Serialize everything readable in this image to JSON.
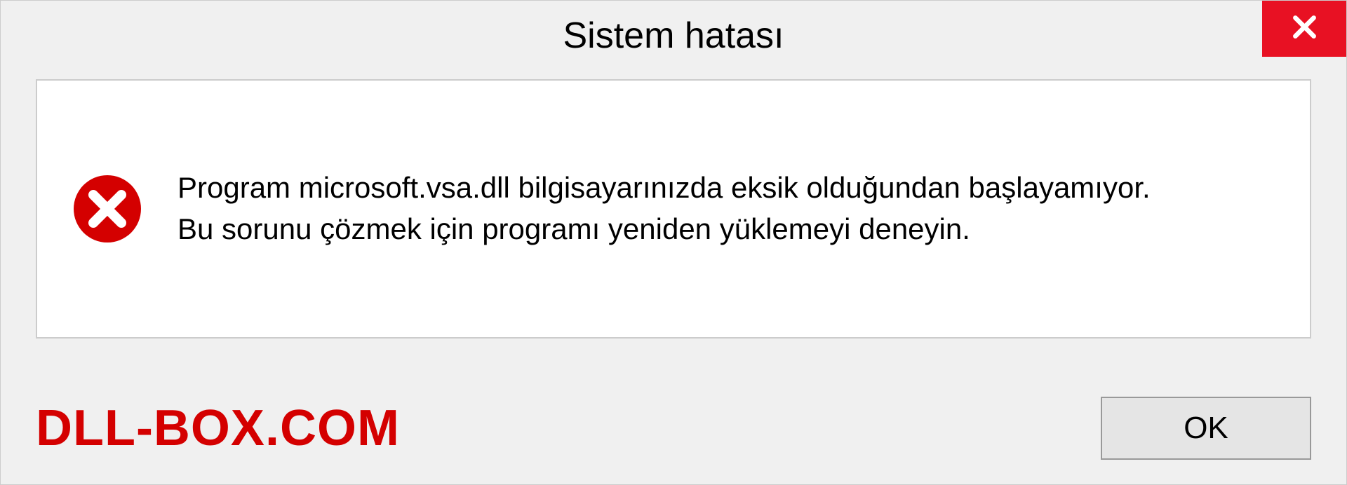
{
  "titlebar": {
    "title": "Sistem hatası"
  },
  "message": {
    "line1": "Program microsoft.vsa.dll bilgisayarınızda eksik olduğundan başlayamıyor.",
    "line2": "Bu sorunu çözmek için programı yeniden yüklemeyi deneyin."
  },
  "watermark": "DLL-BOX.COM",
  "buttons": {
    "ok": "OK"
  },
  "colors": {
    "close_bg": "#e81123",
    "error_icon": "#d40000",
    "watermark": "#d40000"
  }
}
